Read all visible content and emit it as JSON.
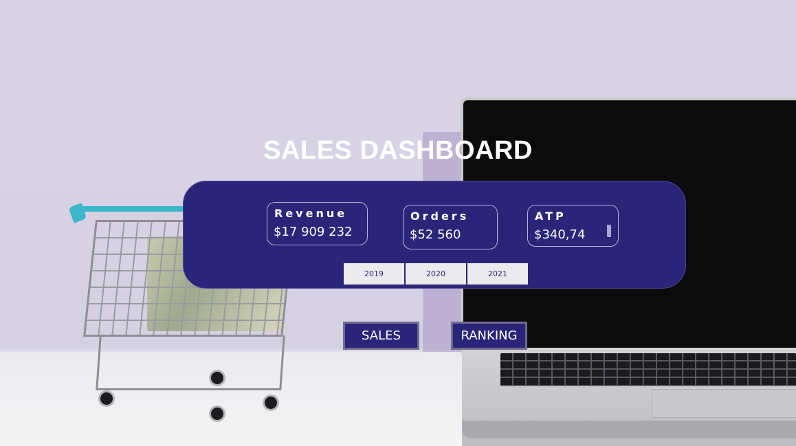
{
  "dashboard": {
    "title": "SALES DASHBOARD"
  },
  "kpis": {
    "revenue": {
      "label": "Revenue",
      "value": "$17 909 232"
    },
    "orders": {
      "label": "Orders",
      "value": "$52 560"
    },
    "atp": {
      "label": "ATP",
      "value": "$340,74"
    }
  },
  "year_filter": [
    "2019",
    "2020",
    "2021"
  ],
  "nav": {
    "sales_label": "SALES",
    "ranking_label": "RANKING"
  },
  "colors": {
    "panel": "#2a2579",
    "accent_handle": "#3ab7c8"
  }
}
